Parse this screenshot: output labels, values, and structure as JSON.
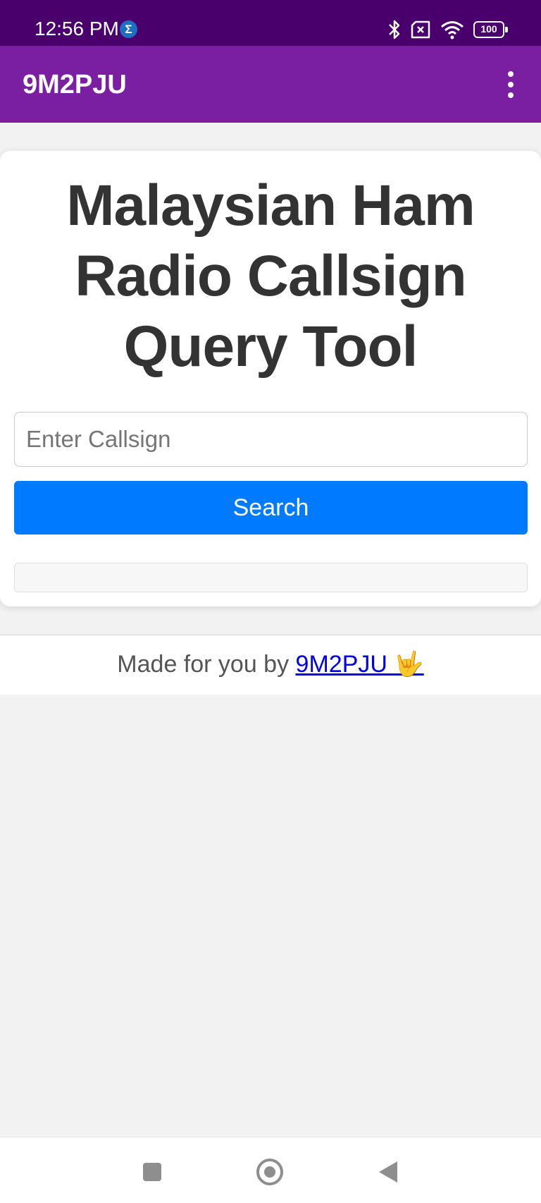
{
  "status_bar": {
    "time": "12:56 PM",
    "notification_icon": "sigma-icon",
    "notification_glyph": "Σ",
    "icons": [
      "bluetooth-icon",
      "muted-sim-icon",
      "wifi-icon",
      "battery-icon"
    ],
    "battery_level": "100"
  },
  "app_bar": {
    "title": "9M2PJU",
    "menu_icon": "overflow-menu-icon"
  },
  "main": {
    "headline": "Malaysian Ham Radio Callsign Query Tool",
    "input_placeholder": "Enter Callsign",
    "input_value": "",
    "search_label": "Search",
    "result_text": ""
  },
  "footer": {
    "prefix": "Made for you by ",
    "link_text": "9M2PJU 🤟"
  },
  "nav_bar": {
    "icons": [
      "recent-apps-icon",
      "home-icon",
      "back-icon"
    ]
  },
  "colors": {
    "status_bar": "#4a006c",
    "app_bar": "#7b1fa2",
    "button": "#007bff",
    "background": "#f2f2f2",
    "headline": "#333333"
  }
}
